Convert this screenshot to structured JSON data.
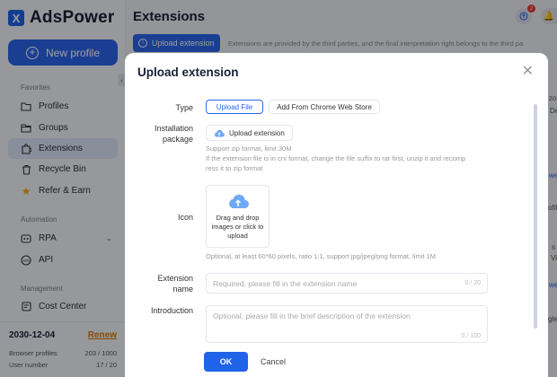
{
  "brand": {
    "name": "AdsPower"
  },
  "sidebar": {
    "new_profile": "New profile",
    "favorites_title": "Favorites",
    "favorites": [
      {
        "label": "Profiles",
        "icon": "folder-icon"
      },
      {
        "label": "Groups",
        "icon": "folder-icon"
      },
      {
        "label": "Extensions",
        "icon": "puzzle-icon"
      },
      {
        "label": "Recycle Bin",
        "icon": "trash-icon"
      },
      {
        "label": "Refer & Earn",
        "icon": "star-icon"
      }
    ],
    "automation_title": "Automation",
    "automation": [
      {
        "label": "RPA",
        "icon": "rpa-icon"
      },
      {
        "label": "API",
        "icon": "api-icon"
      }
    ],
    "management_title": "Management",
    "management": [
      {
        "label": "Cost Center",
        "icon": "cost-center-icon"
      }
    ],
    "footer": {
      "expiry_date": "2030-12-04",
      "renew": "Renew",
      "browser_profiles_label": "Browser profiles",
      "browser_profiles_value": "203 / 1000",
      "user_number_label": "User number",
      "user_number_value": "17 / 20"
    }
  },
  "main": {
    "title": "Extensions",
    "upload_button": "Upload extension",
    "notice": "Extensions are provided by the third parties, and the final interpretation right belongs to the third pa",
    "notification_count": "2",
    "peek": [
      "zo",
      "De",
      "we",
      "ofil",
      "s",
      "Vi",
      "we",
      "gle"
    ]
  },
  "modal": {
    "title": "Upload extension",
    "type_label": "Type",
    "type_options": [
      "Upload File",
      "Add From Chrome Web Store"
    ],
    "type_selected": "Upload File",
    "package_label_1": "Installation",
    "package_label_2": "package",
    "upload_button": "Upload extension",
    "package_hint_1": "Support zip format, limit 30M",
    "package_hint_2": "If the extension file is in crx format, change the file suffix to rar first, unzip it and recomp",
    "package_hint_3": "ress it to zip format",
    "icon_label": "Icon",
    "icon_drop_text": "Drag and drop images or click to upload",
    "icon_hint": "Optional, at least 60*60 pixels, ratio 1:1, support jpg/jpeg/png format, limit 1M",
    "name_label_1": "Extension",
    "name_label_2": "name",
    "name_placeholder": "Required, please fill in the extension name",
    "name_counter": "0 / 20",
    "intro_label": "Introduction",
    "intro_placeholder": "Optional, please fill in the brief description of the extension",
    "intro_counter": "0 / 100",
    "ok": "OK",
    "cancel": "Cancel"
  },
  "colors": {
    "accent": "#2a67ec",
    "renew": "#e07b00",
    "badge": "#e53935"
  }
}
